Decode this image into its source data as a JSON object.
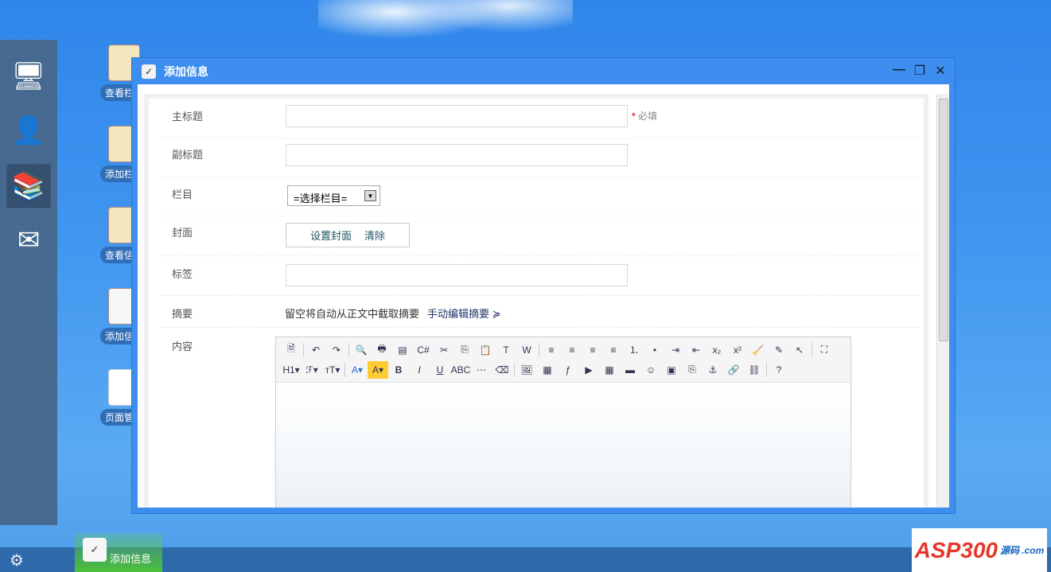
{
  "window": {
    "title": "添加信息",
    "minimize": "—",
    "maximize": "❐",
    "close": "✕"
  },
  "sidebar": {
    "items": [
      {
        "name": "computer",
        "glyph": "🖥"
      },
      {
        "name": "user",
        "glyph": "👤"
      },
      {
        "name": "books",
        "glyph": "📚"
      },
      {
        "name": "mail",
        "glyph": "✉"
      }
    ]
  },
  "desktop": [
    {
      "label": "查看栏目"
    },
    {
      "label": "添加栏目"
    },
    {
      "label": "查看信息"
    },
    {
      "label": "添加信息"
    },
    {
      "label": "页面管理"
    }
  ],
  "form": {
    "title_label": "主标题",
    "required_mark": "*",
    "required_text": "必填",
    "subtitle_label": "副标题",
    "category_label": "栏目",
    "category_value": "=选择栏目=",
    "cover_label": "封面",
    "cover_set": "设置封面",
    "cover_clear": "清除",
    "tags_label": "标签",
    "summary_label": "摘要",
    "summary_hint": "留空将自动从正文中截取摘要",
    "summary_manual": "手动编辑摘要 ≽",
    "content_label": "内容"
  },
  "toolbar": {
    "row1": [
      "source|🗎",
      "|",
      "undo|↶",
      "redo|↷",
      "|",
      "preview|🔍",
      "print|🖶",
      "template|▤",
      "code|C#",
      "cut|✂",
      "copy|⎘",
      "paste|📋",
      "paste-text|T",
      "paste-word|W",
      "|",
      "align-left|≡",
      "align-center|≡",
      "align-right|≡",
      "justify|≡",
      "ordered-list|⒈",
      "unordered-list|•",
      "indent|⇥",
      "outdent|⇤",
      "subscript|x₂",
      "superscript|x²",
      "clear-format|🧹",
      "select-all|✎",
      "select|↖",
      "|",
      "fullscreen|⛶"
    ],
    "row2": [
      "heading|H1▾",
      "font-family|ℱ▾",
      "font-size|тT▾",
      "|",
      "font-color|A▾",
      "highlight|A▾",
      "bold|B",
      "italic|I",
      "underline|U",
      "strikethrough|ABC",
      "hr|⋯",
      "remove-format|⌫",
      "|",
      "image|🖼",
      "multi-image|▦",
      "flash|ƒ",
      "media|▶",
      "table|▦",
      "insert-row|▬",
      "emoticon|☺",
      "image-map|▣",
      "page-break|⎘",
      "anchor|⚓",
      "link|🔗",
      "unlink|⛓",
      "|",
      "help|?"
    ]
  },
  "taskbar": {
    "gear": "⚙",
    "task_label": "添加信息"
  },
  "logo": {
    "text": "ASP300",
    "sub": "源码 .com"
  }
}
